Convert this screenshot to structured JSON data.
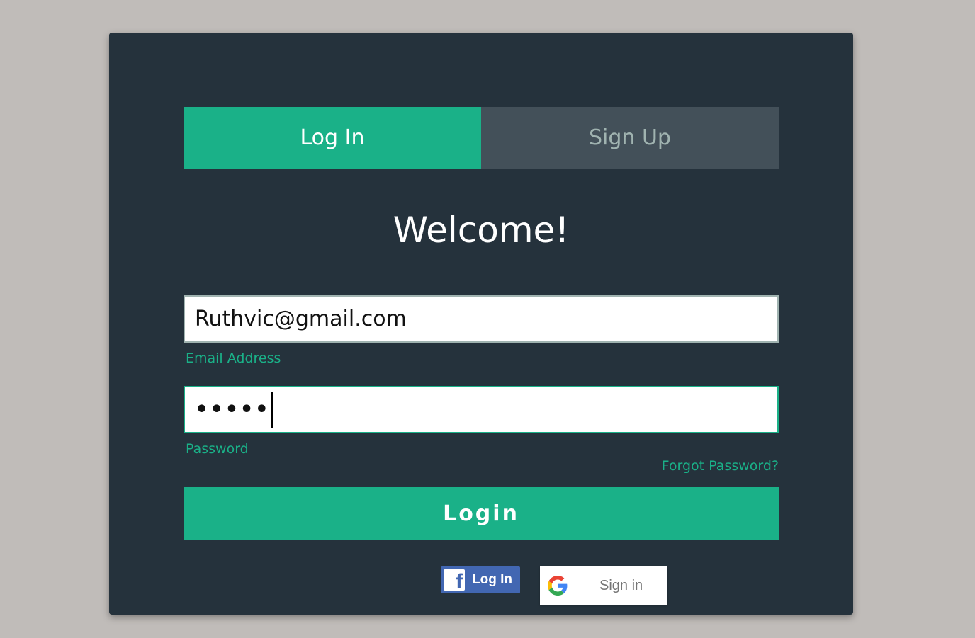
{
  "tabs": {
    "login_label": "Log In",
    "signup_label": "Sign Up"
  },
  "form": {
    "title": "Welcome!",
    "email_value": "Ruthvic@gmail.com",
    "email_label": "Email Address",
    "password_value": "•••••",
    "password_label": "Password",
    "forgot_link": "Forgot Password?",
    "submit_label": "Login"
  },
  "social": {
    "facebook_label": "Log In",
    "facebook_icon": "facebook-f-icon",
    "google_label": "Sign in",
    "google_icon": "google-g-icon"
  },
  "colors": {
    "accent": "#1ab188",
    "card_background": "#25323c",
    "page_background": "#c0bcb9",
    "inactive_tab": "#435059",
    "facebook_blue": "#4267b2"
  }
}
